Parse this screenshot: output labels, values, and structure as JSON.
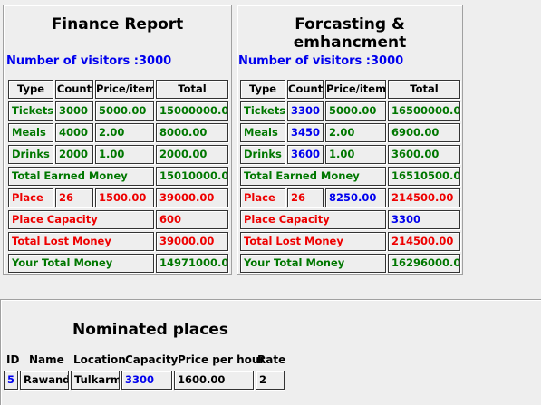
{
  "finance": {
    "title": "Finance Report",
    "visitors": "Number of visitors :3000",
    "headers": [
      "Type",
      "Count",
      "Price/item",
      "Total"
    ],
    "tickets": {
      "type": "Tickets",
      "count": "3000",
      "price": "5000.00",
      "total": "15000000.00"
    },
    "meals": {
      "type": "Meals",
      "count": "4000",
      "price": "2.00",
      "total": "8000.00"
    },
    "drinks": {
      "type": "Drinks",
      "count": "2000",
      "price": "1.00",
      "total": "2000.00"
    },
    "earned": {
      "label": "Total Earned Money",
      "value": "15010000.00"
    },
    "place": {
      "type": "Place",
      "count": "26",
      "price": "1500.00",
      "total": "39000.00"
    },
    "capacity": {
      "label": "Place Capacity",
      "value": "600"
    },
    "lost": {
      "label": "Total Lost Money",
      "value": "39000.00"
    },
    "your_total": {
      "label": "Your Total Money",
      "value": "14971000.00"
    }
  },
  "forecast": {
    "title": "Forcasting & emhancment",
    "visitors": "Number of visitors :3000",
    "headers": [
      "Type",
      "Count",
      "Price/item",
      "Total"
    ],
    "tickets": {
      "type": "Tickets",
      "count": "3300",
      "price": "5000.00",
      "total": "16500000.00"
    },
    "meals": {
      "type": "Meals",
      "count": "3450",
      "price": "2.00",
      "total": "6900.00"
    },
    "drinks": {
      "type": "Drinks",
      "count": "3600",
      "price": "1.00",
      "total": "3600.00"
    },
    "earned": {
      "label": "Total Earned Money",
      "value": "16510500.00"
    },
    "place": {
      "type": "Place",
      "count": "26",
      "price": "8250.00",
      "total": "214500.00"
    },
    "capacity": {
      "label": "Place Capacity",
      "value": "3300"
    },
    "lost": {
      "label": "Total Lost Money",
      "value": "214500.00"
    },
    "your_total": {
      "label": "Your Total Money",
      "value": "16296000.00"
    }
  },
  "nominated": {
    "title": "Nominated places",
    "headers": [
      "ID",
      "Name",
      "Location",
      "Capacity",
      "Price per hour",
      "Rate"
    ],
    "row": {
      "id": "5",
      "name": "Rawand",
      "location": "Tulkarm",
      "capacity": "3300",
      "price": "1600.00",
      "rate": "2"
    }
  },
  "colors": {
    "green": "#007700",
    "red": "#ee0000",
    "blue": "#0000ee",
    "background": "#eeeeee"
  }
}
